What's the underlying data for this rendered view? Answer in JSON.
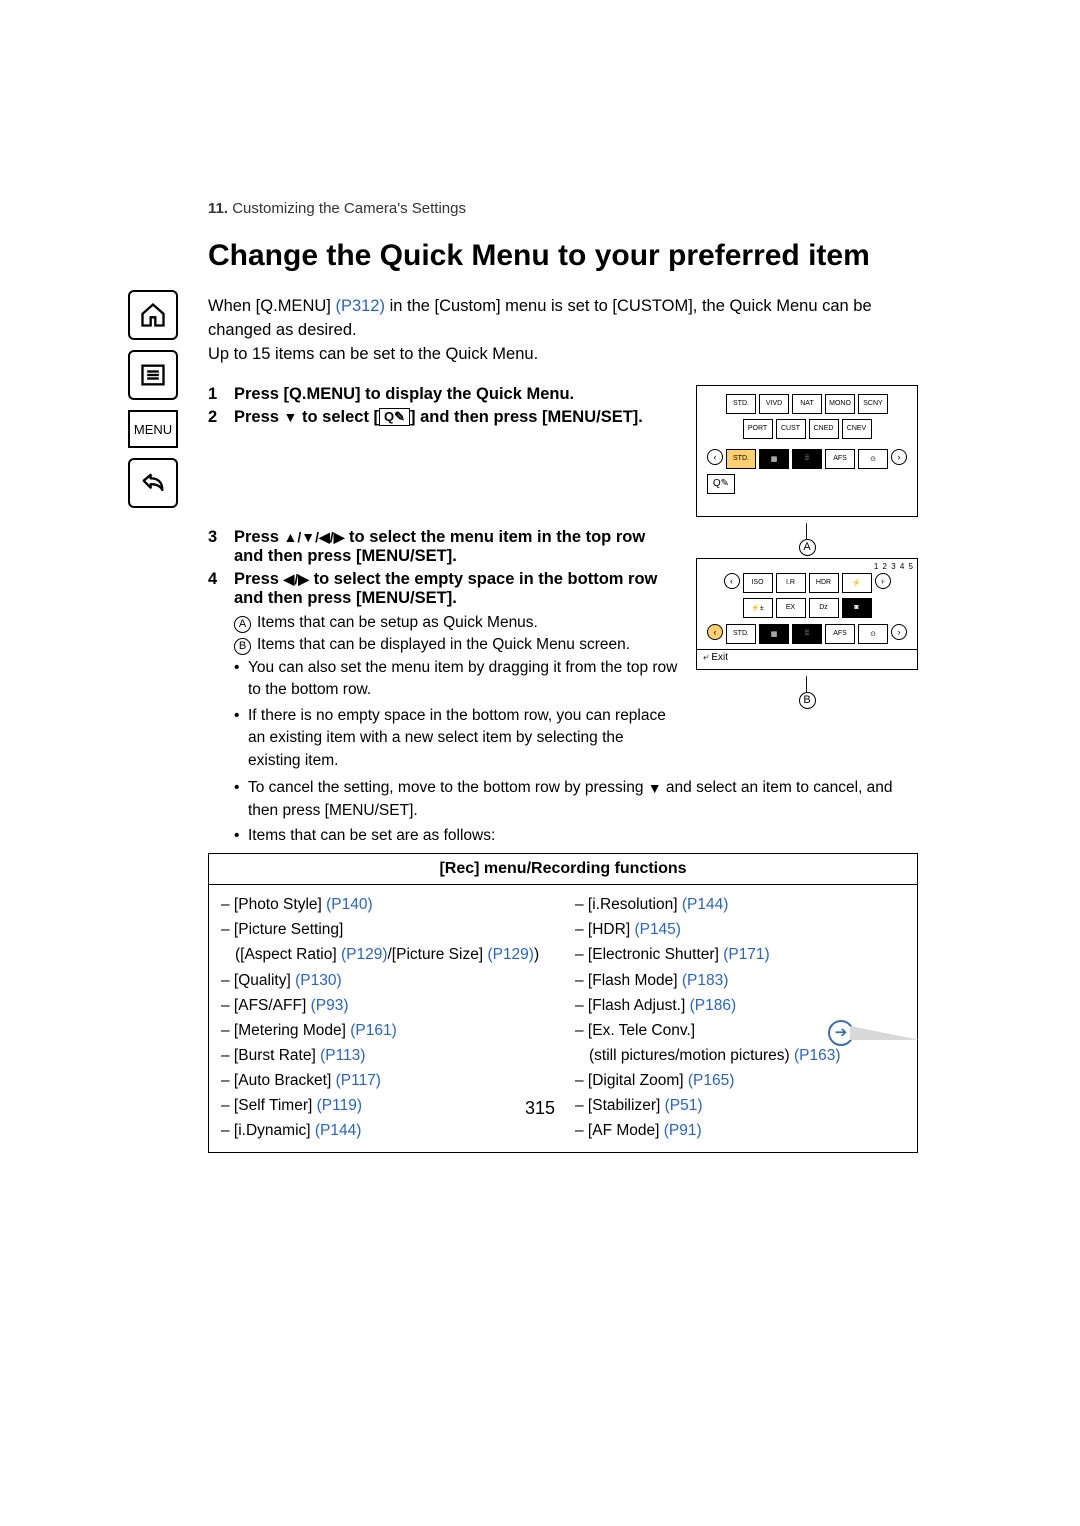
{
  "breadcrumb_num": "11.",
  "breadcrumb_text": " Customizing the Camera's Settings",
  "title": "Change the Quick Menu to your preferred item",
  "intro_a": "When [Q.MENU] ",
  "intro_link1": "(P312)",
  "intro_b": " in the [Custom] menu is set to [CUSTOM], the Quick Menu can be changed as desired.",
  "intro_c": "Up to 15 items can be set to the Quick Menu.",
  "sidebar_menu": "MENU",
  "steps": {
    "s1": "Press [Q.MENU] to display the Quick Menu.",
    "s2a": "Press ",
    "s2b": " to select [",
    "s2c": "] and then press [MENU/SET].",
    "s3a": "Press ",
    "s3b": " to select the menu item in the top row and then press [MENU/SET].",
    "s4a": "Press ",
    "s4b": " to select the empty space in the bottom row and then press [MENU/SET]."
  },
  "annot": {
    "a": "Items that can be setup as Quick Menus.",
    "b": "Items that can be displayed in the Quick Menu screen."
  },
  "bullets": {
    "b1": "You can also set the menu item by dragging it from the top row to the bottom row.",
    "b2": "If there is no empty space in the bottom row, you can replace an existing item with a new select item by selecting the existing item.",
    "b3a": "To cancel the setting, move to the bottom row by pressing ",
    "b3b": " and select an item to cancel, and then press [MENU/SET].",
    "b4": "Items that can be set are as follows:"
  },
  "illus": {
    "exit": "Exit",
    "afs": "AFS",
    "pages": "1 2 3 4 5",
    "markerA": "A",
    "markerB": "B"
  },
  "table": {
    "header": "[Rec] menu/Recording functions",
    "left": [
      {
        "t": "[Photo Style] ",
        "p": "(P140)"
      },
      {
        "t": "[Picture Setting]",
        "p": ""
      },
      {
        "t": "([Aspect Ratio] ",
        "p": "(P129)",
        "t2": "/[Picture Size] ",
        "p2": "(P129)",
        "t3": ")",
        "indent": true
      },
      {
        "t": "[Quality] ",
        "p": "(P130)"
      },
      {
        "t": "[AFS/AFF] ",
        "p": "(P93)"
      },
      {
        "t": "[Metering Mode] ",
        "p": "(P161)"
      },
      {
        "t": "[Burst Rate] ",
        "p": "(P113)"
      },
      {
        "t": "[Auto Bracket] ",
        "p": "(P117)"
      },
      {
        "t": "[Self Timer] ",
        "p": "(P119)"
      },
      {
        "t": "[i.Dynamic] ",
        "p": "(P144)"
      }
    ],
    "right": [
      {
        "t": "[i.Resolution] ",
        "p": "(P144)"
      },
      {
        "t": "[HDR] ",
        "p": "(P145)"
      },
      {
        "t": "[Electronic Shutter] ",
        "p": "(P171)"
      },
      {
        "t": "[Flash Mode] ",
        "p": "(P183)"
      },
      {
        "t": "[Flash Adjust.] ",
        "p": "(P186)"
      },
      {
        "t": "[Ex. Tele Conv.]",
        "p": ""
      },
      {
        "t": "(still pictures/motion pictures) ",
        "p": "(P163)",
        "indent": true
      },
      {
        "t": "[Digital Zoom] ",
        "p": "(P165)"
      },
      {
        "t": "[Stabilizer] ",
        "p": "(P51)"
      },
      {
        "t": "[AF Mode] ",
        "p": "(P91)"
      }
    ]
  },
  "page_number": "315"
}
